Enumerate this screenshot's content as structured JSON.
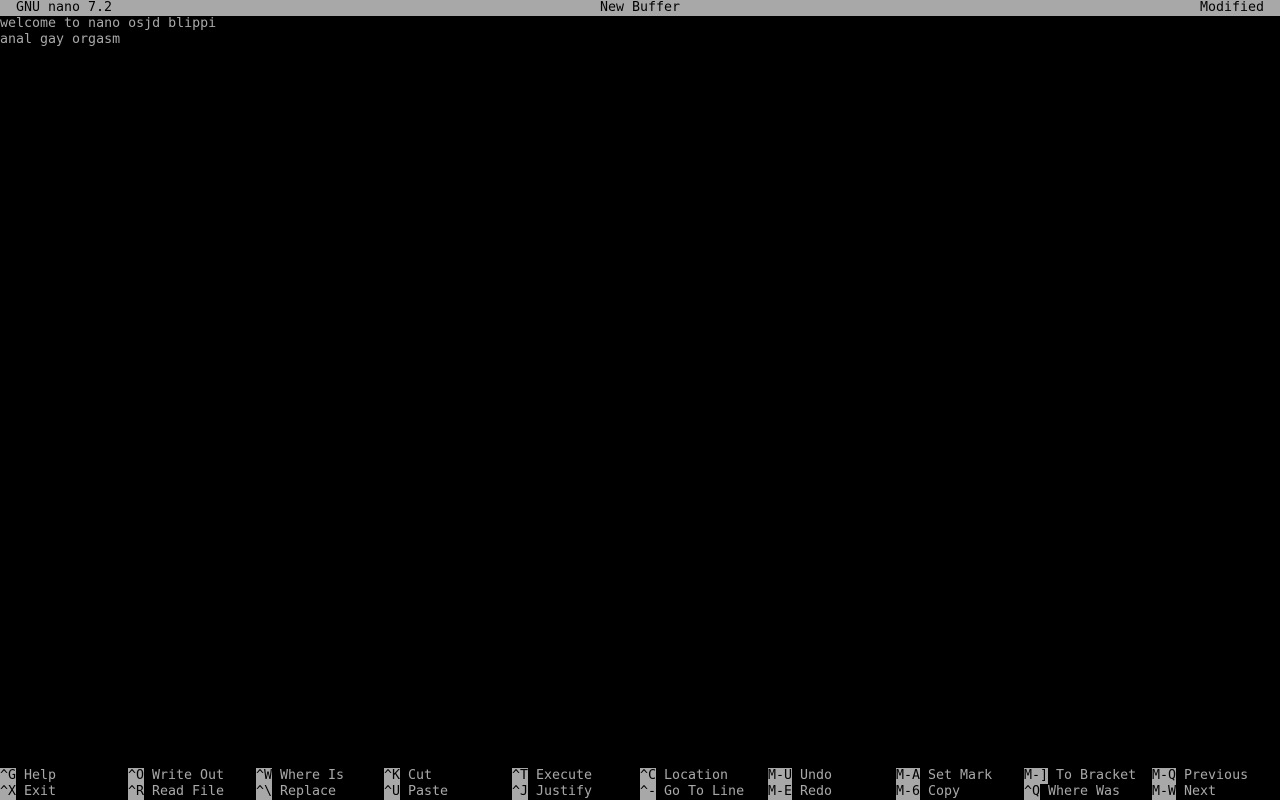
{
  "titlebar": {
    "app": "GNU nano 7.2",
    "buffer": "New Buffer",
    "status": "Modified"
  },
  "editor": {
    "lines": [
      "welcome to nano osjd blippi",
      "anal gay orgasm"
    ]
  },
  "shortcuts": {
    "row1": [
      {
        "key": "^G",
        "label": "Help"
      },
      {
        "key": "^O",
        "label": "Write Out"
      },
      {
        "key": "^W",
        "label": "Where Is"
      },
      {
        "key": "^K",
        "label": "Cut"
      },
      {
        "key": "^T",
        "label": "Execute"
      },
      {
        "key": "^C",
        "label": "Location"
      },
      {
        "key": "M-U",
        "label": "Undo"
      },
      {
        "key": "M-A",
        "label": "Set Mark"
      },
      {
        "key": "M-]",
        "label": "To Bracket"
      },
      {
        "key": "M-Q",
        "label": "Previous"
      }
    ],
    "row2": [
      {
        "key": "^X",
        "label": "Exit"
      },
      {
        "key": "^R",
        "label": "Read File"
      },
      {
        "key": "^\\",
        "label": "Replace"
      },
      {
        "key": "^U",
        "label": "Paste"
      },
      {
        "key": "^J",
        "label": "Justify"
      },
      {
        "key": "^-",
        "label": "Go To Line"
      },
      {
        "key": "M-E",
        "label": "Redo"
      },
      {
        "key": "M-6",
        "label": "Copy"
      },
      {
        "key": "^Q",
        "label": "Where Was"
      },
      {
        "key": "M-W",
        "label": "Next"
      }
    ]
  }
}
